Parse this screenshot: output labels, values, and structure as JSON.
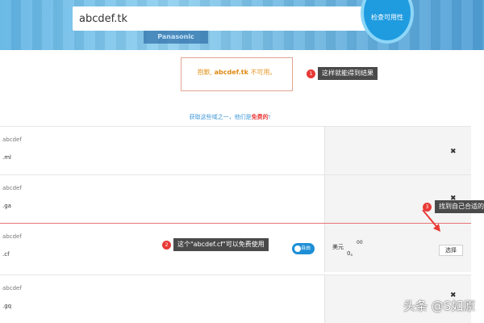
{
  "search": {
    "value": "abcdef.tk",
    "check_label": "检查可用性"
  },
  "banner": {
    "billboard_text": "Panasonic"
  },
  "result": {
    "prefix": "抱歉,",
    "domain": "abcdef.tk",
    "suffix": "不可用。"
  },
  "callouts": [
    {
      "num": "1",
      "text": "这样就能得到结果"
    },
    {
      "num": "2",
      "text": "这个\"abcdef.cf\"可以免费使用"
    },
    {
      "num": "3",
      "text": "找到自己合适的"
    }
  ],
  "promo": {
    "text": "获取这些域之一，他们是",
    "bold": "免费的",
    "end": "!"
  },
  "rows": [
    {
      "name": "abcdef",
      "tld": ".ml",
      "status": "✖"
    },
    {
      "name": "abcdef",
      "tld": ".ga",
      "status": "✖"
    },
    {
      "name": "abcdef",
      "tld": ".cf",
      "badge": "自由",
      "currency": "美元",
      "amount": "0。",
      "cents": "00",
      "select": "选择"
    },
    {
      "name": "abcdef",
      "tld": ".gq",
      "status": "✖"
    }
  ],
  "watermark": "头条 @S如原"
}
